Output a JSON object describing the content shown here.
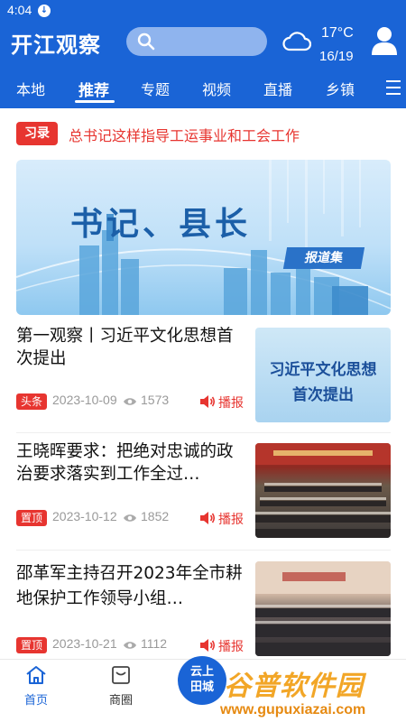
{
  "status": {
    "time": "4:04"
  },
  "header": {
    "logo": "开江观察",
    "search_icon": "search-icon",
    "weather_icon": "cloud-icon",
    "temperature": "17°C",
    "temperature_range": "16/19",
    "avatar_icon": "user-icon"
  },
  "nav": {
    "tabs": [
      {
        "label": "本地"
      },
      {
        "label": "推荐",
        "active": true
      },
      {
        "label": "专题"
      },
      {
        "label": "视频"
      },
      {
        "label": "直播"
      },
      {
        "label": "乡镇"
      }
    ],
    "menu_icon": "menu-icon"
  },
  "ticker": {
    "badge": "习录",
    "text": "总书记这样指导工运事业和工会工作"
  },
  "banner": {
    "title": "书记、县长",
    "tag": "报道集"
  },
  "articles": [
    {
      "title": "第一观察丨习近平文化思想首次提出",
      "badge": "头条",
      "date": "2023-10-09",
      "views": "1573",
      "play_label": "播报",
      "thumb_text_1": "习近平文化思想",
      "thumb_text_2": "首次提出"
    },
    {
      "title": "王晓晖要求：把绝对忠诚的政治要求落实到工作全过…",
      "badge": "置顶",
      "date": "2023-10-12",
      "views": "1852",
      "play_label": "播报"
    },
    {
      "title": "邵革军主持召开2023年全市耕地保护工作领导小组…",
      "badge": "置顶",
      "date": "2023-10-21",
      "views": "1112",
      "play_label": "播报"
    }
  ],
  "bottom": {
    "tabs": [
      {
        "label": "首页",
        "icon": "home-icon",
        "active": true
      },
      {
        "label": "商圈",
        "icon": "shop-icon"
      }
    ],
    "center_line1": "云上",
    "center_line2": "田城"
  },
  "watermark": {
    "text": "谷普软件园",
    "url": "www.gupuxiazai.com"
  },
  "colors": {
    "brand_blue": "#1a64d6",
    "accent_red": "#e73530",
    "watermark_orange": "#f2a627"
  }
}
